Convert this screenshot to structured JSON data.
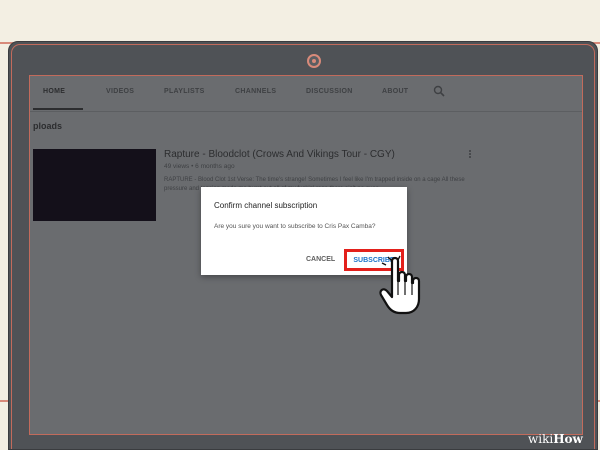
{
  "channel_nav": {
    "tabs": [
      {
        "label": "HOME"
      },
      {
        "label": "VIDEOS"
      },
      {
        "label": "PLAYLISTS"
      },
      {
        "label": "CHANNELS"
      },
      {
        "label": "DISCUSSION"
      },
      {
        "label": "ABOUT"
      }
    ],
    "active_tab": "HOME",
    "search_icon": "search-icon"
  },
  "uploads": {
    "section_title": "ploads",
    "video": {
      "title": "Rapture - Bloodclot (Crows And Vikings Tour - CGY)",
      "meta": "49 views • 6 months ago",
      "description": "RAPTURE - Blood Clot 1st Verse: The time's strange! Sometimes I feel like I'm trapped inside on a cage All these pressure and tension made me burst out all of my fuckin' rage there ain't no ques..."
    }
  },
  "dialog": {
    "title": "Confirm channel subscription",
    "body": "Are you sure you want to subscribe to Cris Pax Camba?",
    "cancel_label": "CANCEL",
    "subscribe_label": "SUBSCRIBE"
  },
  "watermark": {
    "wiki": "wiki",
    "how": "How"
  },
  "colors": {
    "highlight": "#e3201b",
    "subscribe_text": "#1a73c9",
    "overlay": "#6a6c6f"
  }
}
